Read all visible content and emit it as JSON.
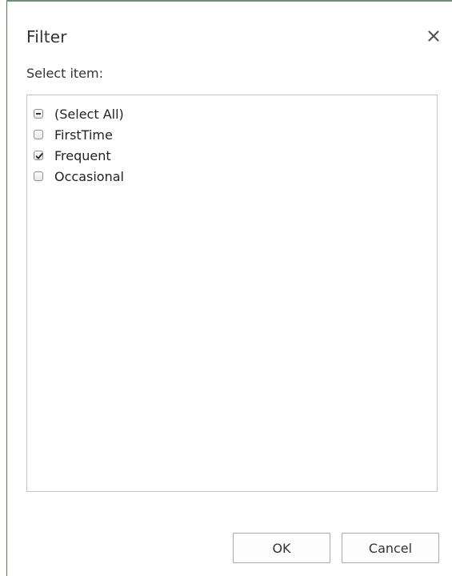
{
  "dialog": {
    "title": "Filter",
    "close_icon": "close-icon",
    "prompt": "Select item:"
  },
  "filter_list": {
    "items": [
      {
        "label": "(Select All)",
        "state": "indeterminate"
      },
      {
        "label": "FirstTime",
        "state": "unchecked"
      },
      {
        "label": "Frequent",
        "state": "checked"
      },
      {
        "label": "Occasional",
        "state": "unchecked"
      }
    ]
  },
  "buttons": {
    "ok_label": "OK",
    "cancel_label": "Cancel"
  },
  "colors": {
    "sheet_border": "#4f7c5a",
    "text": "#333333",
    "list_border": "#c6c6c6",
    "button_border": "#ababab"
  }
}
